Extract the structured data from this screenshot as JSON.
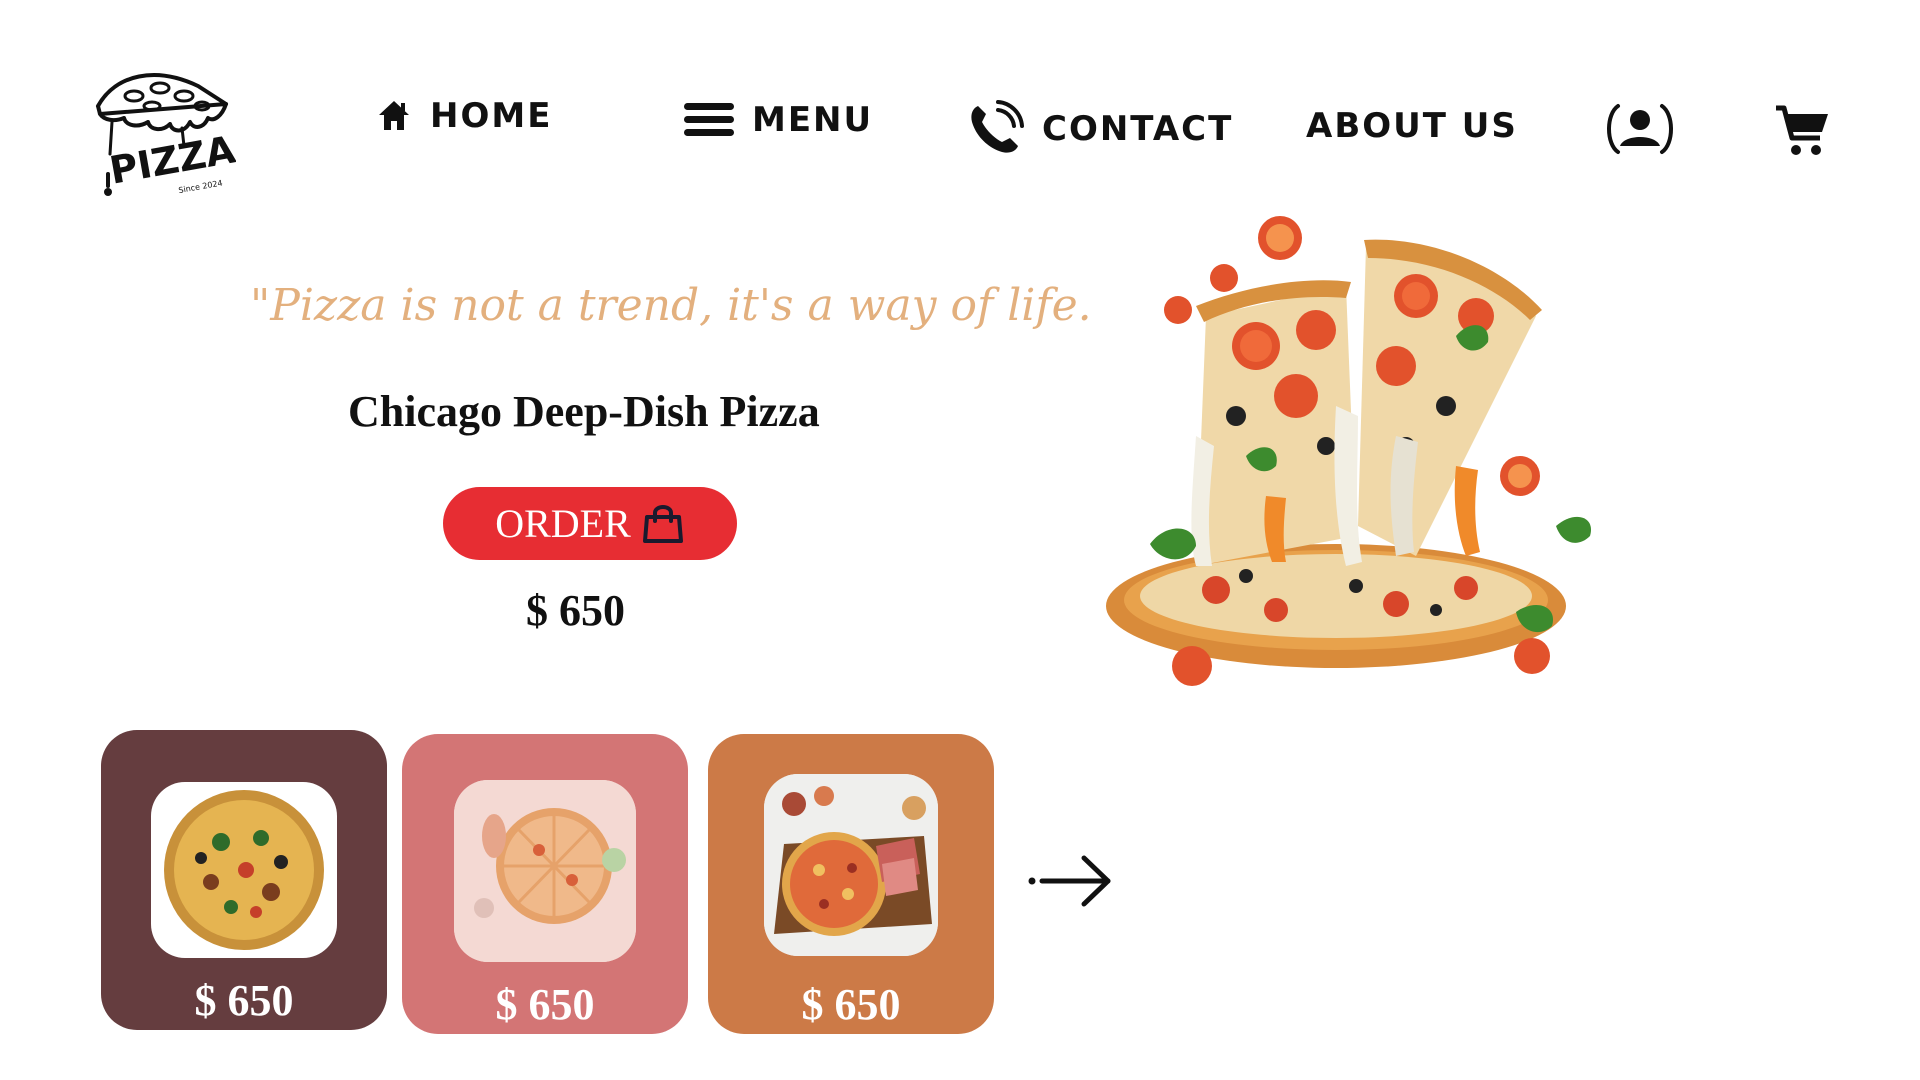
{
  "header": {
    "logo_text": "PIZZA",
    "logo_tagline": "Since 2024",
    "nav": {
      "home": "HOME",
      "menu": "MENU",
      "contact": "CONTACT",
      "about": "ABOUT US"
    },
    "icons": [
      "logo-icon",
      "home-icon",
      "hamburger-icon",
      "phone-icon",
      "user-icon",
      "cart-icon"
    ]
  },
  "hero": {
    "quote": "\"Pizza is not a trend, it's a way of life.",
    "title": "Chicago Deep-Dish Pizza",
    "order_label": "ORDER",
    "price": "$ 650"
  },
  "cards": [
    {
      "price": "$ 650",
      "color": "#653d3f"
    },
    {
      "price": "$ 650",
      "color": "#d37575"
    },
    {
      "price": "$ 650",
      "color": "#cc7a47"
    }
  ],
  "colors": {
    "accent_red": "#e72d33",
    "quote_gold": "#e3b07e",
    "text": "#111111"
  }
}
